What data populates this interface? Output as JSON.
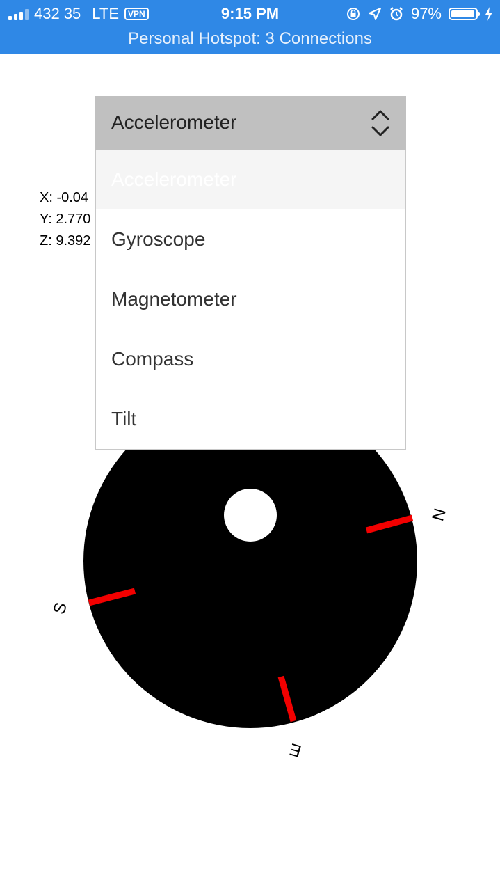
{
  "status_bar": {
    "carrier": "432 35",
    "network": "LTE",
    "vpn": "VPN",
    "time": "9:15 PM",
    "battery": "97%",
    "battery_level": 0.97,
    "hotspot": "Personal Hotspot: 3 Connections"
  },
  "readouts": {
    "x": "X: -0.04",
    "y": "Y: 2.770",
    "z": "Z: 9.392"
  },
  "sensor_select": {
    "selected": "Accelerometer",
    "options": [
      "Accelerometer",
      "Gyroscope",
      "Magnetometer",
      "Compass",
      "Tilt"
    ]
  },
  "compass": {
    "labels": {
      "n": "N",
      "s": "S",
      "e": "E"
    },
    "colors": {
      "dial": "#000000",
      "marker": "#f20000",
      "hole": "#ffffff"
    }
  }
}
